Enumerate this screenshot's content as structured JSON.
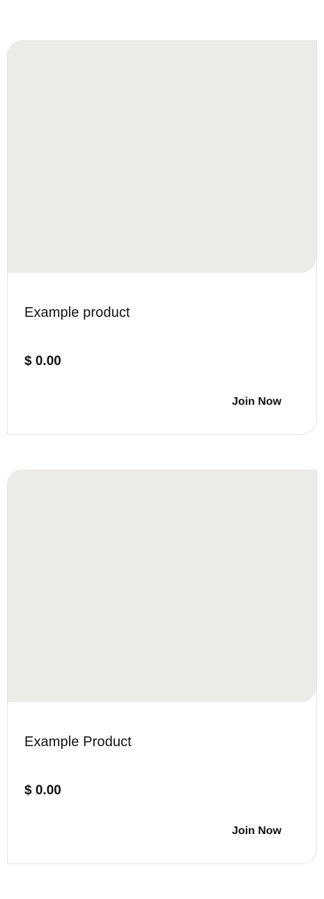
{
  "products": [
    {
      "title": "Example product",
      "price": "$ 0.00",
      "cta_label": "Join Now"
    },
    {
      "title": "Example Product",
      "price": "$ 0.00",
      "cta_label": "Join Now"
    }
  ],
  "colors": {
    "image_placeholder": "#edebe8",
    "card_border": "#e2e1de",
    "text": "#111111"
  }
}
